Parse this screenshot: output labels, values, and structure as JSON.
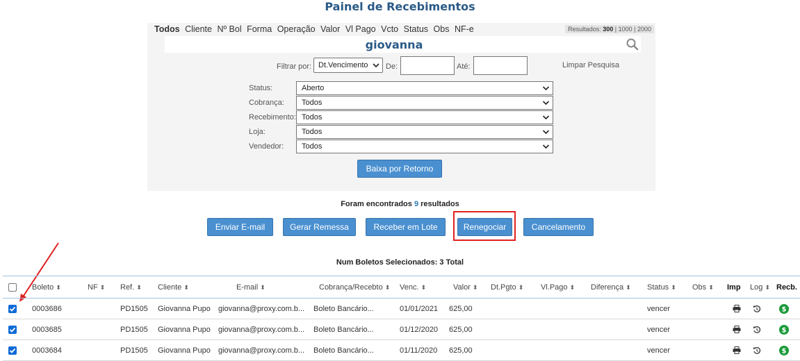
{
  "page": {
    "title": "Painel de Recebimentos"
  },
  "search": {
    "fields": [
      "Todos",
      "Cliente",
      "Nº Bol",
      "Forma",
      "Operação",
      "Valor",
      "Vl Pago",
      "Vcto",
      "Status",
      "Obs",
      "NF-e"
    ],
    "results_label": "Resultados:",
    "results_options": [
      "300",
      "1000",
      "2000"
    ],
    "query": "giovanna",
    "filter_label": "Filtrar por:",
    "filter_value": "Dt.Vencimento",
    "de_label": "De:",
    "ate_label": "Até:",
    "limpar": "Limpar Pesquisa"
  },
  "filters": [
    {
      "label": "Status:",
      "value": "Aberto"
    },
    {
      "label": "Cobrança:",
      "value": "Todos"
    },
    {
      "label": "Recebimento:",
      "value": "Todos"
    },
    {
      "label": "Loja:",
      "value": "Todos"
    },
    {
      "label": "Vendedor:",
      "value": "Todos"
    }
  ],
  "baixa_button": "Baixa por Retorno",
  "found": {
    "prefix": "Foram encontrados",
    "count": "9",
    "suffix": "resultados"
  },
  "actions": [
    "Enviar E-mail",
    "Gerar Remessa",
    "Receber em Lote",
    "Renegociar",
    "Cancelamento"
  ],
  "selected_text": "Num Boletos Selecionados: 3 Total",
  "table": {
    "headers": [
      "Boleto",
      "NF",
      "Ref.",
      "Cliente",
      "E-mail",
      "Cobrança/Recebto",
      "Venc.",
      "Valor",
      "Dt.Pgto",
      "Vl.Pago",
      "Diferença",
      "Status",
      "Obs",
      "Imp",
      "Log",
      "Recb."
    ],
    "rows": [
      {
        "boleto": "0003686",
        "nf": "",
        "ref": "PD1505",
        "cliente": "Giovanna Pupo",
        "email": "giovanna@proxy.com.b...",
        "cobranca": "Boleto Bancário...",
        "venc": "01/01/2021",
        "valor": "625,00",
        "dtpgto": "",
        "vlpago": "",
        "diferenca": "",
        "status": "vencer",
        "obs": ""
      },
      {
        "boleto": "0003685",
        "nf": "",
        "ref": "PD1505",
        "cliente": "Giovanna Pupo",
        "email": "giovanna@proxy.com.b...",
        "cobranca": "Boleto Bancário...",
        "venc": "01/12/2020",
        "valor": "625,00",
        "dtpgto": "",
        "vlpago": "",
        "diferenca": "",
        "status": "vencer",
        "obs": ""
      },
      {
        "boleto": "0003684",
        "nf": "",
        "ref": "PD1505",
        "cliente": "Giovanna Pupo",
        "email": "giovanna@proxy.com.b...",
        "cobranca": "Boleto Bancário...",
        "venc": "01/11/2020",
        "valor": "625,00",
        "dtpgto": "",
        "vlpago": "",
        "diferenca": "",
        "status": "vencer",
        "obs": ""
      }
    ]
  },
  "colors": {
    "title": "#2a5a86",
    "button": "#4a90d0",
    "highlight": "#e02020",
    "checkbox": "#0f6bd8",
    "money_icon": "#1a9a3a"
  }
}
